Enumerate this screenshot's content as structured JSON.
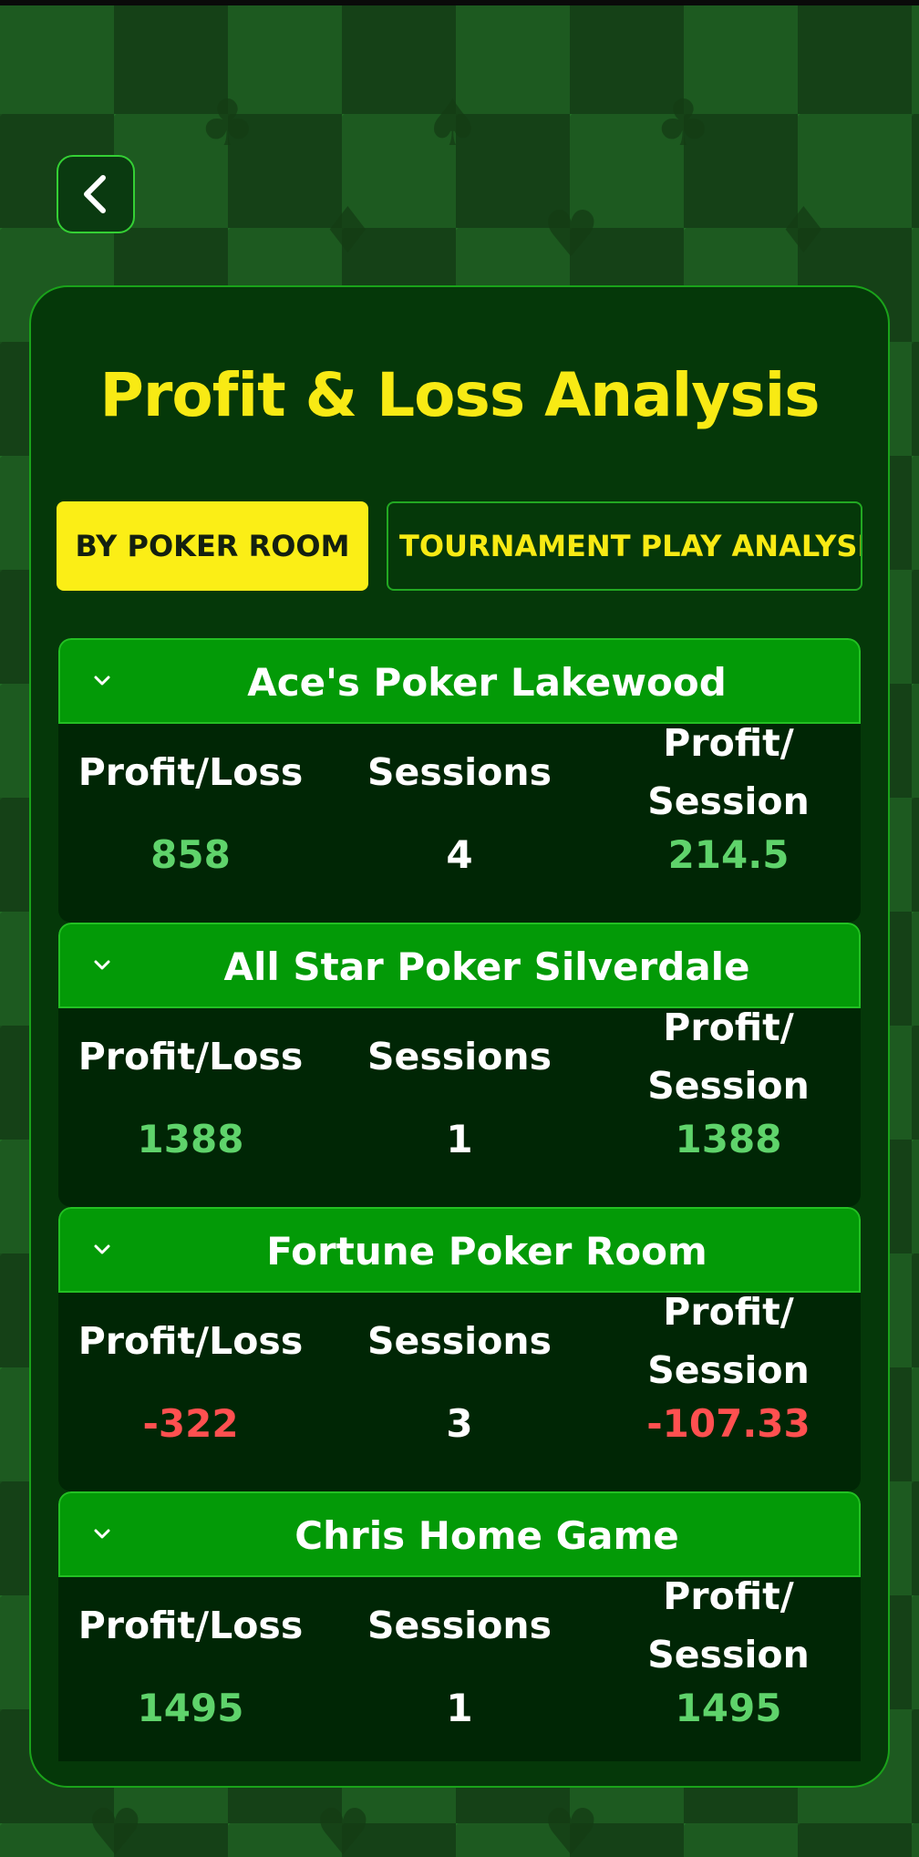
{
  "title": "Profit & Loss Analysis",
  "tabs": [
    {
      "label": "BY POKER ROOM",
      "active": true
    },
    {
      "label": "TOURNAMENT PLAY ANALYSIS",
      "active": false
    }
  ],
  "column_labels": {
    "profit_loss": "Profit/Loss",
    "sessions": "Sessions",
    "profit_session_line1": "Profit/",
    "profit_session_line2": "Session"
  },
  "rooms": [
    {
      "name": "Ace's Poker Lakewood",
      "profit_loss": "858",
      "sessions": "4",
      "profit_per_session": "214.5",
      "status": "positive"
    },
    {
      "name": "All Star Poker Silverdale",
      "profit_loss": "1388",
      "sessions": "1",
      "profit_per_session": "1388",
      "status": "positive"
    },
    {
      "name": "Fortune Poker Room",
      "profit_loss": "-322",
      "sessions": "3",
      "profit_per_session": "-107.33",
      "status": "negative"
    },
    {
      "name": "Chris Home Game",
      "profit_loss": "1495",
      "sessions": "1",
      "profit_per_session": "1495",
      "status": "positive"
    }
  ],
  "colors": {
    "accent_yellow": "#f8ea14",
    "header_green": "#039a07",
    "positive": "#5fd36b",
    "negative": "#ff5050"
  },
  "icons": {
    "back": "chevron-left-icon",
    "expand": "chevron-down-icon"
  }
}
